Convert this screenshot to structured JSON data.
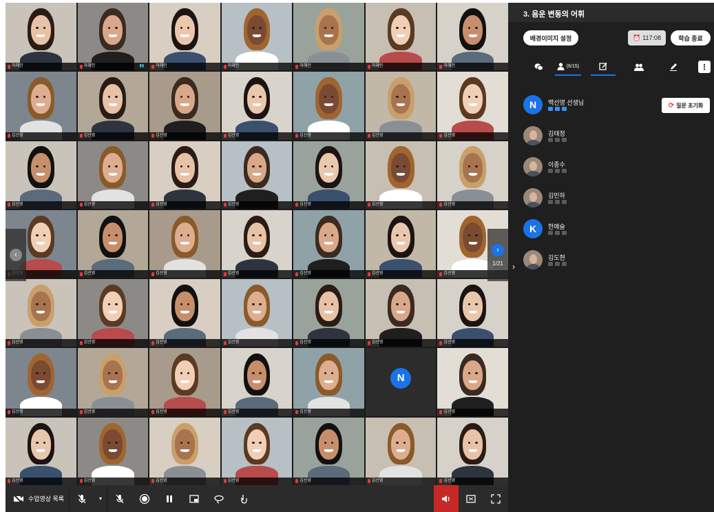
{
  "header": {
    "title": "3. 음운 변동의 어휘"
  },
  "controls": {
    "bg_image_label": "배경이미지 설정",
    "timer": "117:08",
    "end_label": "학습 종료",
    "reset_question_label": "질문 초기화"
  },
  "tabs": {
    "participants_count": "(6/15)",
    "more_glyph": "⋮"
  },
  "participants": [
    {
      "name": "백선영 선생님",
      "avatar": "N",
      "avatar_type": "letter",
      "status": "on"
    },
    {
      "name": "김태정",
      "avatar": "",
      "avatar_type": "photo",
      "status": "off"
    },
    {
      "name": "이종수",
      "avatar": "",
      "avatar_type": "photo",
      "status": "off"
    },
    {
      "name": "김민하",
      "avatar": "",
      "avatar_type": "photo",
      "status": "off"
    },
    {
      "name": "한예슬",
      "avatar": "K",
      "avatar_type": "letter",
      "status": "off"
    },
    {
      "name": "김도현",
      "avatar": "",
      "avatar_type": "photo",
      "status": "off"
    }
  ],
  "grid": {
    "page": "1/21",
    "tiles": [
      {
        "name": "자혜인",
        "type": "video"
      },
      {
        "name": "자혜인",
        "type": "video"
      },
      {
        "name": "자혜인",
        "type": "video"
      },
      {
        "name": "자혜인",
        "type": "video"
      },
      {
        "name": "자혜인",
        "type": "video"
      },
      {
        "name": "자혜인",
        "type": "video"
      },
      {
        "name": "자혜인",
        "type": "video"
      },
      {
        "name": "김선영",
        "type": "video"
      },
      {
        "name": "김선영",
        "type": "video"
      },
      {
        "name": "김선영",
        "type": "video"
      },
      {
        "name": "김선영",
        "type": "video"
      },
      {
        "name": "김선영",
        "type": "video"
      },
      {
        "name": "김선영",
        "type": "video"
      },
      {
        "name": "김선영",
        "type": "video"
      },
      {
        "name": "김선영",
        "type": "video"
      },
      {
        "name": "김선영",
        "type": "video"
      },
      {
        "name": "김선영",
        "type": "video"
      },
      {
        "name": "김선영",
        "type": "video"
      },
      {
        "name": "김선영",
        "type": "video"
      },
      {
        "name": "김선영",
        "type": "video"
      },
      {
        "name": "김선영",
        "type": "video"
      },
      {
        "name": "김선영",
        "type": "video"
      },
      {
        "name": "김선영",
        "type": "video"
      },
      {
        "name": "김선영",
        "type": "video"
      },
      {
        "name": "김선영",
        "type": "video"
      },
      {
        "name": "김선영",
        "type": "video"
      },
      {
        "name": "김선영",
        "type": "video"
      },
      {
        "name": "김선영",
        "type": "video"
      },
      {
        "name": "김선영",
        "type": "video"
      },
      {
        "name": "김선영",
        "type": "video"
      },
      {
        "name": "김선영",
        "type": "video"
      },
      {
        "name": "김선영",
        "type": "video"
      },
      {
        "name": "김선영",
        "type": "video"
      },
      {
        "name": "김선영",
        "type": "video"
      },
      {
        "name": "김선영",
        "type": "video"
      },
      {
        "name": "김선영",
        "type": "video"
      },
      {
        "name": "김선영",
        "type": "video"
      },
      {
        "name": "김선영",
        "type": "video"
      },
      {
        "name": "김선영",
        "type": "video"
      },
      {
        "name": "김선영",
        "type": "video"
      },
      {
        "name": "",
        "type": "avatar",
        "avatar": "N"
      },
      {
        "name": "김선영",
        "type": "video"
      },
      {
        "name": "김선영",
        "type": "video"
      },
      {
        "name": "김선영",
        "type": "video"
      },
      {
        "name": "김선영",
        "type": "video"
      },
      {
        "name": "김선영",
        "type": "video"
      },
      {
        "name": "김선영",
        "type": "video"
      },
      {
        "name": "김선영",
        "type": "video"
      },
      {
        "name": "김선영",
        "type": "video"
      }
    ]
  },
  "toolbar": {
    "lecture_list_label": "수업영상 목록"
  },
  "colors": {
    "accent": "#1a73e8",
    "speaker_active": "#c62828",
    "panel_bg": "#1f1f1f",
    "toolbar_bg": "#2b2b2b"
  }
}
